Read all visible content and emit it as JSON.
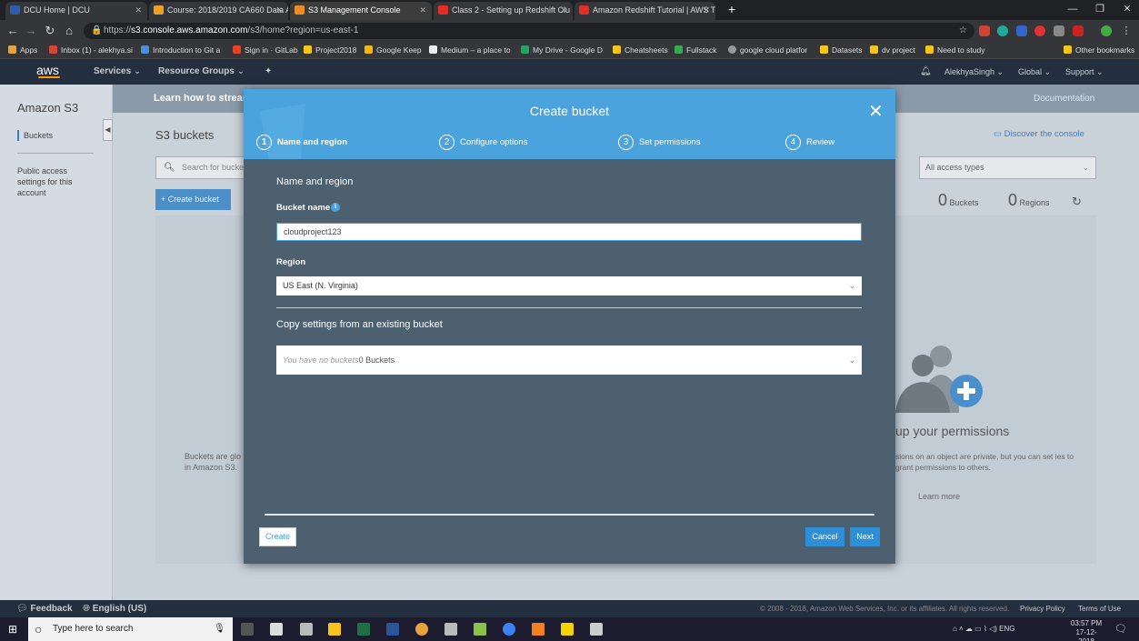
{
  "browser": {
    "tabs": [
      {
        "label": "DCU Home | DCU",
        "color": "#2a5db0"
      },
      {
        "label": "Course: 2018/2019 CA660 Data A",
        "color": "#f0a020"
      },
      {
        "label": "S3 Management Console",
        "color": "#f08a24",
        "active": true
      },
      {
        "label": "Class 2 - Setting up Redshift Clu",
        "color": "#e52d27"
      },
      {
        "label": "Amazon Redshift Tutorial | AWS T",
        "color": "#e52d27"
      }
    ],
    "url_prefix": "https://",
    "url_host": "s3.console.aws.amazon.com",
    "url_path": "/s3/home?region=us-east-1",
    "bookmarks": [
      {
        "label": "Apps",
        "color": "#e8a33d"
      },
      {
        "label": "Inbox (1) - alekhya.si",
        "color": "#d44638"
      },
      {
        "label": "Introduction to Git a",
        "color": "#4a90d9"
      },
      {
        "label": "Sign in · GitLab",
        "color": "#e24329"
      },
      {
        "label": "Project2018",
        "color": "#f5c518"
      },
      {
        "label": "Google Keep",
        "color": "#f5b800"
      },
      {
        "label": "Medium – a place to",
        "color": "#eeeeee"
      },
      {
        "label": "My Drive - Google D",
        "color": "#1fa463"
      },
      {
        "label": "Cheatsheets",
        "color": "#f5c518"
      },
      {
        "label": "Fullstack",
        "color": "#3aa757"
      },
      {
        "label": "google cloud platfor",
        "color": "#999999"
      },
      {
        "label": "Datasets",
        "color": "#f5c518"
      },
      {
        "label": "dv project",
        "color": "#f5c518"
      },
      {
        "label": "Need to study",
        "color": "#f5c518"
      },
      {
        "label": "Other bookmarks",
        "color": "#f5c518"
      }
    ]
  },
  "aws_nav": {
    "logo": "aws",
    "services": "Services",
    "resource_groups": "Resource Groups",
    "user": "AlekhyaSingh",
    "region": "Global",
    "support": "Support"
  },
  "sidebar": {
    "title": "Amazon S3",
    "items": [
      "Buckets",
      "Public access settings for this account"
    ]
  },
  "page": {
    "banner": "Learn how to stream",
    "documentation": "Documentation",
    "title": "S3 buckets",
    "discover": "Discover the console",
    "search_placeholder": "Search for bucke",
    "access_filter": "All access types",
    "create_bucket": "Create bucket",
    "buckets_count": "0",
    "buckets_label": "Buckets",
    "regions_count": "0",
    "regions_label": "Regions",
    "empty_left": "Buckets are glo in Amazon S3.",
    "perm_title": "up your permissions",
    "perm_text": "sions on an object are private, but you can set ies to grant permissions to others.",
    "learn_more": "Learn more"
  },
  "modal": {
    "title": "Create bucket",
    "steps": [
      {
        "num": "1",
        "label": "Name and region"
      },
      {
        "num": "2",
        "label": "Configure options"
      },
      {
        "num": "3",
        "label": "Set permissions"
      },
      {
        "num": "4",
        "label": "Review"
      }
    ],
    "section_heading": "Name and region",
    "bucket_name_label": "Bucket name",
    "bucket_name_value": "cloudproject123",
    "region_label": "Region",
    "region_value": "US East (N. Virginia)",
    "copy_heading": "Copy settings from an existing bucket",
    "copy_placeholder": "You have no buckets",
    "copy_count": "0 Buckets",
    "create_button": "Create",
    "cancel_button": "Cancel",
    "next_button": "Next"
  },
  "footer": {
    "feedback": "Feedback",
    "language": "English (US)",
    "copyright": "© 2008 - 2018, Amazon Web Services, Inc. or its affiliates. All rights reserved.",
    "privacy": "Privacy Policy",
    "terms": "Terms of Use"
  },
  "taskbar": {
    "search_placeholder": "Type here to search",
    "lang": "ENG",
    "time": "03:57 PM",
    "date": "17-12-2018"
  }
}
